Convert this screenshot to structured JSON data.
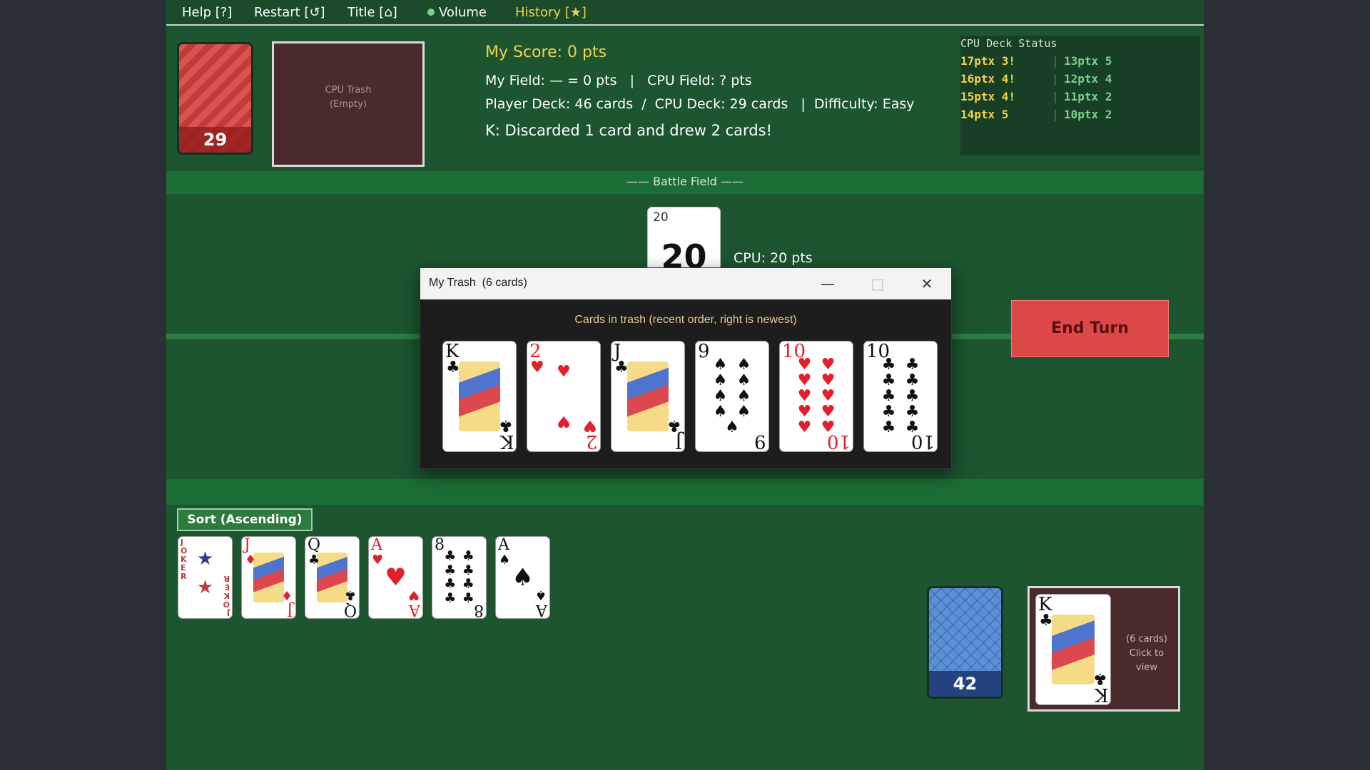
{
  "menu": {
    "help": "Help [?]",
    "restart": "Restart [↺]",
    "title": "Title [⌂]",
    "volume": "Volume",
    "history": "History [★]"
  },
  "cpu": {
    "deck_count": "29",
    "trash_label": "CPU Trash",
    "trash_state": "(Empty)"
  },
  "info": {
    "score": "My Score: 0 pts",
    "fields": "My Field: — = 0 pts   |   CPU Field: ? pts",
    "decks": "Player Deck: 46 cards  /  CPU Deck: 29 cards   |  Difficulty: Easy",
    "message": "K: Discarded 1 card and drew 2 cards!"
  },
  "cpu_status": {
    "title": "CPU Deck Status",
    "rows": [
      {
        "left": "17ptx 3!",
        "sep": "|",
        "right": "13ptx 5"
      },
      {
        "left": "16ptx 4!",
        "sep": "|",
        "right": "12ptx 4"
      },
      {
        "left": "15ptx 4!",
        "sep": "|",
        "right": "11ptx 2"
      },
      {
        "left": "14ptx 5",
        "sep": "|",
        "right": "10ptx 2"
      }
    ]
  },
  "battle": {
    "label": "—— Battle Field ——",
    "cpu_card_small": "20",
    "cpu_card_big": "20",
    "cpu_points": "CPU: 20 pts"
  },
  "end_turn": "End Turn",
  "sort_button": "Sort (Ascending)",
  "player": {
    "deck_count": "42",
    "trash_info_line1": "(6 cards)",
    "trash_info_line2": "Click to view",
    "trash_top": {
      "rank": "K",
      "suit": "♣"
    }
  },
  "hand": [
    {
      "rank": "JOKER",
      "suit": "★"
    },
    {
      "rank": "J",
      "suit": "♦"
    },
    {
      "rank": "Q",
      "suit": "♣"
    },
    {
      "rank": "A",
      "suit": "♥"
    },
    {
      "rank": "8",
      "suit": "♣"
    },
    {
      "rank": "A",
      "suit": "♠"
    }
  ],
  "dialog": {
    "title": "My Trash  (6 cards)",
    "subtitle": "Cards in trash (recent order, right is newest)",
    "minimize": "—",
    "maximize": "□",
    "close": "✕",
    "cards": [
      {
        "rank": "K",
        "suit": "♣"
      },
      {
        "rank": "2",
        "suit": "♥"
      },
      {
        "rank": "J",
        "suit": "♣"
      },
      {
        "rank": "9",
        "suit": "♠"
      },
      {
        "rank": "10",
        "suit": "♥"
      },
      {
        "rank": "10",
        "suit": "♣"
      }
    ]
  }
}
